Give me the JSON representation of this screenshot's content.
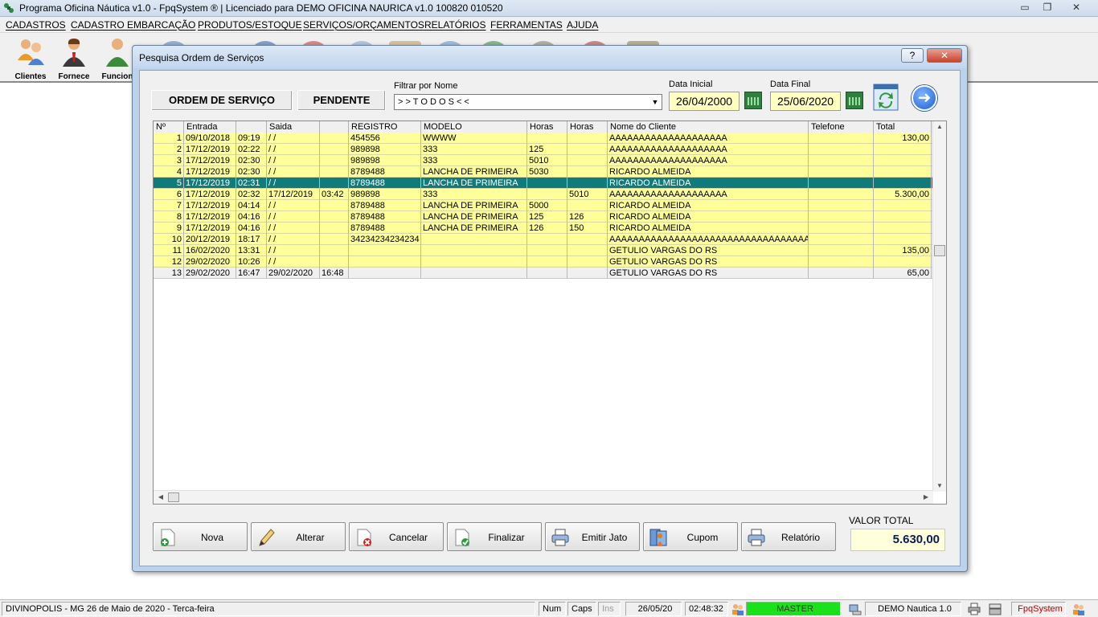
{
  "window": {
    "title": "Programa Oficina Náutica v1.0 - FpqSystem ® | Licenciado para  DEMO OFICINA NAURICA v1.0 100820 010520",
    "minimize": "▭",
    "restore": "❐",
    "close": "✕"
  },
  "menu": [
    "CADASTROS",
    "CADASTRO EMBARCAÇÃO",
    "PRODUTOS/ESTOQUE",
    "SERVIÇOS/ORÇAMENTOS",
    "RELATÓRIOS",
    "FERRAMENTAS",
    "AJUDA"
  ],
  "toolbar": [
    {
      "label": "Clientes",
      "icon": "clients-icon"
    },
    {
      "label": "Fornece",
      "icon": "supplier-icon"
    },
    {
      "label": "Funcion",
      "icon": "employee-icon"
    }
  ],
  "dialog": {
    "title": "Pesquisa Ordem de Serviços",
    "help": "?",
    "close": "✕",
    "label_os": "ORDEM DE SERVIÇO",
    "label_status": "PENDENTE",
    "filter_label": "Filtrar por Nome",
    "filter_value": "> > T O D O S < <",
    "date_start_label": "Data Inicial",
    "date_start": "26/04/2000",
    "date_end_label": "Data Final",
    "date_end": "25/06/2020",
    "go": "➜"
  },
  "grid": {
    "headers": [
      "Nº",
      "Entrada",
      "",
      "Saida",
      "",
      "REGISTRO",
      "MODELO",
      "Horas",
      "Horas",
      "Nome do Cliente",
      "Telefone",
      "Total"
    ],
    "rows": [
      [
        "1",
        "09/10/2018",
        "09:19",
        " / /",
        "",
        "454556",
        "WWWW",
        "",
        "",
        "AAAAAAAAAAAAAAAAAAAA",
        "",
        "130,00"
      ],
      [
        "2",
        "17/12/2019",
        "02:22",
        " / /",
        "",
        "989898",
        "333",
        "125",
        "",
        "AAAAAAAAAAAAAAAAAAAA",
        "",
        ""
      ],
      [
        "3",
        "17/12/2019",
        "02:30",
        " / /",
        "",
        "989898",
        "333",
        "5010",
        "",
        "AAAAAAAAAAAAAAAAAAAA",
        "",
        ""
      ],
      [
        "4",
        "17/12/2019",
        "02:30",
        " / /",
        "",
        "8789488",
        "LANCHA DE PRIMEIRA",
        "5030",
        "",
        "RICARDO ALMEIDA",
        "",
        ""
      ],
      [
        "5",
        "17/12/2019",
        "02:31",
        " / /",
        "",
        "8789488",
        "LANCHA DE PRIMEIRA",
        "",
        "",
        "RICARDO ALMEIDA",
        "",
        ""
      ],
      [
        "6",
        "17/12/2019",
        "02:32",
        "17/12/2019",
        "03:42",
        "989898",
        "333",
        "",
        "5010",
        "AAAAAAAAAAAAAAAAAAAA",
        "",
        "5.300,00"
      ],
      [
        "7",
        "17/12/2019",
        "04:14",
        " / /",
        "",
        "8789488",
        "LANCHA DE PRIMEIRA",
        "5000",
        "",
        "RICARDO ALMEIDA",
        "",
        ""
      ],
      [
        "8",
        "17/12/2019",
        "04:16",
        " / /",
        "",
        "8789488",
        "LANCHA DE PRIMEIRA",
        "125",
        "126",
        "RICARDO ALMEIDA",
        "",
        ""
      ],
      [
        "9",
        "17/12/2019",
        "04:16",
        " / /",
        "",
        "8789488",
        "LANCHA DE PRIMEIRA",
        "126",
        "150",
        "RICARDO ALMEIDA",
        "",
        ""
      ],
      [
        "10",
        "20/12/2019",
        "18:17",
        " / /",
        "",
        "34234234234234",
        "",
        "",
        "",
        "AAAAAAAAAAAAAAAAAAAAAAAAAAAAAAAAAAAA",
        "",
        ""
      ],
      [
        "11",
        "16/02/2020",
        "13:31",
        " / /",
        "",
        "",
        "",
        "",
        "",
        "GETULIO VARGAS DO RS",
        "",
        "135,00"
      ],
      [
        "12",
        "29/02/2020",
        "10:26",
        " / /",
        "",
        "",
        "",
        "",
        "",
        "GETULIO VARGAS DO RS",
        "",
        ""
      ],
      [
        "13",
        "29/02/2020",
        "16:47",
        "29/02/2020",
        "16:48",
        "",
        "",
        "",
        "",
        "GETULIO VARGAS DO RS",
        "",
        "65,00"
      ]
    ],
    "selected_row": 5,
    "finished_row": 13
  },
  "actions": [
    {
      "label": "Nova",
      "icon": "new-document-icon"
    },
    {
      "label": "Alterar",
      "icon": "edit-pencil-icon"
    },
    {
      "label": "Cancelar",
      "icon": "cancel-document-icon"
    },
    {
      "label": "Finalizar",
      "icon": "finish-document-icon"
    },
    {
      "label": "Emitir Jato",
      "icon": "printer-icon"
    },
    {
      "label": "Cupom",
      "icon": "receipt-icon"
    },
    {
      "label": "Relatório",
      "icon": "report-printer-icon"
    }
  ],
  "total": {
    "label": "VALOR TOTAL",
    "value": "5.630,00"
  },
  "status": {
    "location_date": "DIVINOPOLIS - MG 26 de Maio de 2020 - Terca-feira",
    "num": "Num",
    "caps": "Caps",
    "ins": "Ins",
    "date": "26/05/20",
    "time": "02:48:32",
    "user": "MASTER",
    "version": "DEMO Nautica 1.0",
    "brand": "FpqSystem"
  },
  "colors": {
    "row_yellow": "#ffff99",
    "row_selected": "#0f7b7b",
    "user_green": "#1be11b",
    "brand_red": "#c00000"
  }
}
